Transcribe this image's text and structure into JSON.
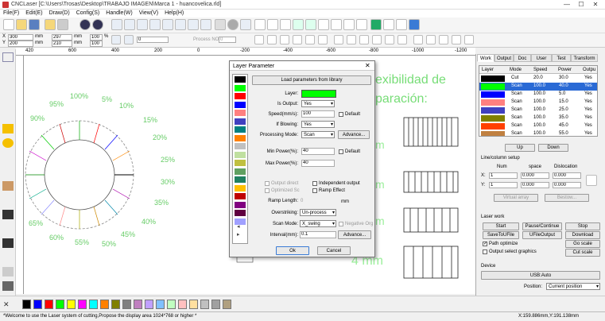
{
  "window": {
    "title": "CNCLaser  [C:\\Users\\Trosas\\Desktop\\TRABAJO IMAGEN\\Marca 1 - huancovelica.rld]",
    "min": "—",
    "max": "☐",
    "close": "✕"
  },
  "menu": [
    "File(F)",
    "Edit(E)",
    "Draw(D)",
    "Config(S)",
    "Handle(W)",
    "View(V)",
    "Help(H)"
  ],
  "toolbar2": {
    "x_label": "X",
    "x_val": "300",
    "x_unit": "mm",
    "w_val": "297",
    "w_unit": "mm",
    "pct1": "100",
    "pct_unit": "%",
    "y_label": "Y",
    "y_val": "200",
    "y_unit": "mm",
    "h_val": "210",
    "h_unit": "mm",
    "pct2": "100",
    "angle": "0",
    "process_no_label": "Process NO:",
    "process_no": "0"
  },
  "ruler_top": [
    "420",
    "600",
    "400",
    "200",
    "0",
    "-200",
    "-400",
    "-600",
    "-800",
    "-1000",
    "-1200"
  ],
  "canvas": {
    "pct_labels": [
      "100%",
      "5%",
      "95%",
      "10%",
      "90%",
      "15%",
      "20%",
      "25%",
      "30%",
      "35%",
      "40%",
      "45%",
      "50%",
      "55%",
      "60%",
      "65%"
    ],
    "text1": "exibilidad de",
    "text2": "paración:",
    "mm1": "m",
    "mm2": "m",
    "mm3": "m",
    "mm4": "4 mm"
  },
  "dialog": {
    "title": "Layer Parameter",
    "close": "✕",
    "load_btn": "Load parameters from library",
    "layer_label": "Layer:",
    "is_output_label": "Is Output:",
    "is_output": "Yes",
    "speed_label": "Speed(mm/s):",
    "speed": "100",
    "default1": "Default",
    "if_blowing_label": "If Blowing:",
    "if_blowing": "Yes",
    "processing_mode_label": "Processing Mode:",
    "processing_mode": "Scan",
    "advance1": "Advance...",
    "min_power_label": "Min Power(%):",
    "min_power": "40",
    "default2": "Default",
    "max_power_label": "Max Power(%):",
    "max_power": "40",
    "output_direct": "Output direct",
    "independent_output": "Independent output",
    "optimized_sc": "Optimized Sc",
    "ramp_effect": "Ramp Effect",
    "ramp_length_label": "Ramp Length:",
    "ramp_length": "0",
    "ramp_unit": "mm",
    "overstriking_label": "Overstriking:",
    "overstriking": "Un-process",
    "scan_mode_label": "Scan Mode:",
    "scan_mode": "X_swing",
    "negative_org": "Negative Org",
    "interval_label": "Interval(mm):",
    "interval": "0.1",
    "advance2": "Advance...",
    "ok": "Ok",
    "cancel": "Cancel",
    "layer_colors": [
      "#000000",
      "#00ff00",
      "#ff0000",
      "#0000ff",
      "#ff8080",
      "#4040c0",
      "#008080",
      "#ff8000",
      "#c0c0c0",
      "#c0e0a0",
      "#c0c040",
      "#60a060",
      "#208060",
      "#ffc000",
      "#c00000",
      "#800080",
      "#600040",
      "#a0a0ff"
    ]
  },
  "right": {
    "tabs": [
      "Work",
      "Output",
      "Doc",
      "User",
      "Test",
      "Transform"
    ],
    "table_headers": [
      "Layer",
      "Mode",
      "Speed",
      "Power",
      "Outpu"
    ],
    "rows": [
      {
        "color": "#000000",
        "mode": "Cut",
        "speed": "20.0",
        "power": "30.0",
        "out": "Yes"
      },
      {
        "color": "#00ff00",
        "mode": "Scan",
        "speed": "100.0",
        "power": "40.0",
        "out": "Yes"
      },
      {
        "color": "#0000ff",
        "mode": "Scan",
        "speed": "100.0",
        "power": "5.0",
        "out": "Yes"
      },
      {
        "color": "#ff8080",
        "mode": "Scan",
        "speed": "100.0",
        "power": "15.0",
        "out": "Yes"
      },
      {
        "color": "#4040c0",
        "mode": "Scan",
        "speed": "100.0",
        "power": "25.0",
        "out": "Yes"
      },
      {
        "color": "#808000",
        "mode": "Scan",
        "speed": "100.0",
        "power": "35.0",
        "out": "Yes"
      },
      {
        "color": "#ff4000",
        "mode": "Scan",
        "speed": "100.0",
        "power": "45.0",
        "out": "Yes"
      },
      {
        "color": "#c08040",
        "mode": "Scan",
        "speed": "100.0",
        "power": "55.0",
        "out": "Yes"
      }
    ],
    "up": "Up",
    "down": "Down",
    "line_col_setup": "Line/column setup",
    "num_label": "Num",
    "space_label": "space",
    "dislocation_label": "Dislocation",
    "x_label": "X:",
    "x_num": "1",
    "x_space": "0.000",
    "x_disl": "0.000",
    "y_label": "Y:",
    "y_num": "1",
    "y_space": "0.000",
    "y_disl": "0.000",
    "virtual_array": "Virtual array",
    "bestow": "Bestow...",
    "laser_work": "Laser work",
    "start": "Start",
    "pause": "Pause/Continue",
    "stop": "Stop",
    "save_ufile": "SaveToUFile",
    "ufile_output": "UFileOutput",
    "download": "Download",
    "path_optimize": "Path optimize",
    "go_scale": "Go scale",
    "output_select": "Output select graphics",
    "cut_scale": "Cut scale",
    "device_label": "Device",
    "device": "USB:Auto",
    "position_label": "Position:",
    "position": "Current position"
  },
  "palette": [
    "#000000",
    "#0000ff",
    "#ff0000",
    "#00ff00",
    "#ffff00",
    "#ff00ff",
    "#00ffff",
    "#ff8000",
    "#808000",
    "#808080",
    "#c080c0",
    "#c0a0ff",
    "#80c0ff",
    "#c0ffc0",
    "#ffc0c0",
    "#ffe0a0",
    "#c0c0c0",
    "#a0a0a0",
    "#b0a080"
  ],
  "status": {
    "message": "*Welcome to use the Laser system of cutting,Propose the display area 1024*768 or higher *",
    "coords": "X:159.886mm,Y:191.138mm"
  }
}
